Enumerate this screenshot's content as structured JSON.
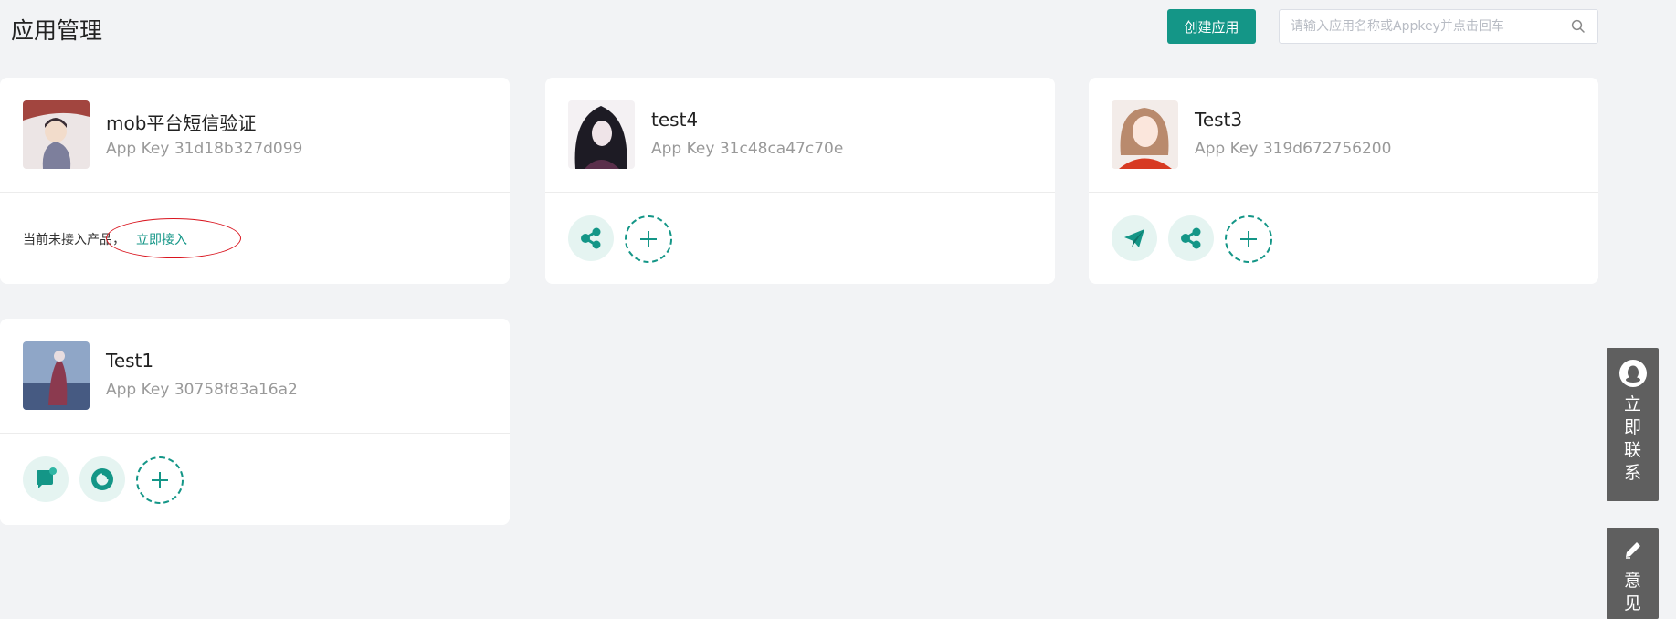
{
  "header": {
    "title": "应用管理",
    "create_label": "创建应用",
    "search_placeholder": "请输入应用名称或Appkey并点击回车"
  },
  "apps": [
    {
      "name": "mob平台短信验证",
      "app_key": "App Key 31d18b327d099",
      "notice": "当前未接入产品，",
      "connect_label": "立即接入",
      "avatar": "avatar-anime-boy-red-umbrella",
      "products": []
    },
    {
      "name": "test4",
      "app_key": "App Key 31c48ca47c70e",
      "avatar": "avatar-anime-dark-hair",
      "products": [
        "share-icon"
      ]
    },
    {
      "name": "Test3",
      "app_key": "App Key 319d672756200",
      "avatar": "avatar-anime-girl-red",
      "products": [
        "paper-plane-icon",
        "share-icon"
      ]
    },
    {
      "name": "Test1",
      "app_key": "App Key 30758f83a16a2",
      "avatar": "avatar-anime-blue-warrior",
      "products": [
        "chat-bubble-icon",
        "ring-swirl-icon"
      ]
    }
  ],
  "side": {
    "contact_label": "立即联系",
    "feedback_label": "意见"
  },
  "colors": {
    "accent": "#149687",
    "accent_light": "#e5f4f1",
    "background": "#f2f3f5",
    "annotation": "#d9141e",
    "side_panel": "#5f5f5f"
  }
}
